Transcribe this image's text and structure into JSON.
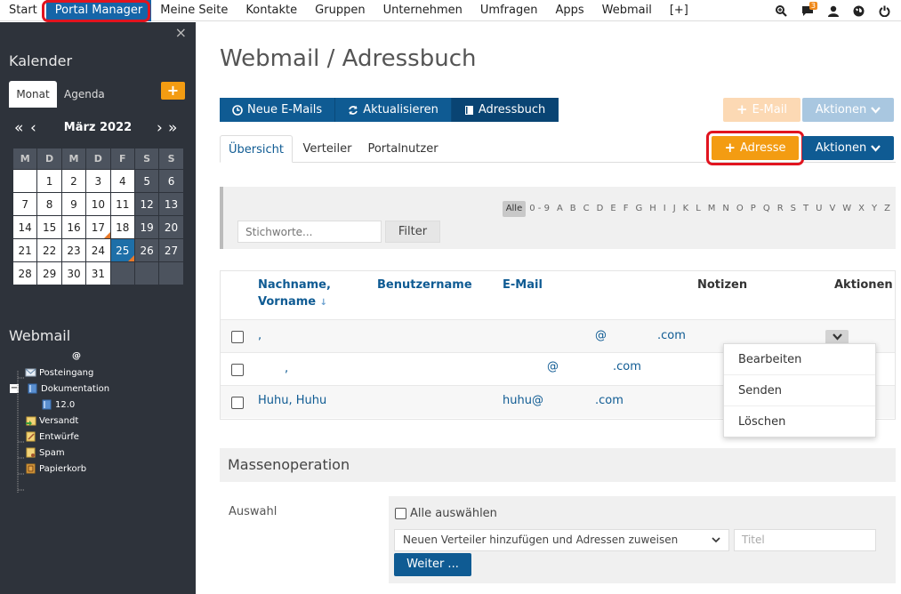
{
  "topnav": {
    "items": [
      "Start",
      "Portal Manager",
      "Meine Seite",
      "Kontakte",
      "Gruppen",
      "Unternehmen",
      "Umfragen",
      "Apps",
      "Webmail",
      "[+]"
    ],
    "active": "Portal Manager",
    "notification_count": "3"
  },
  "sidebar": {
    "close": "×",
    "calendar_heading": "Kalender",
    "tabs": [
      "Monat",
      "Agenda"
    ],
    "add": "+",
    "nav": {
      "prev_year": "«",
      "prev_month": "‹",
      "next_month": "›",
      "next_year": "»"
    },
    "month_label": "März 2022",
    "weekdays": [
      "M",
      "D",
      "M",
      "D",
      "F",
      "S",
      "S"
    ],
    "weeks": [
      [
        "",
        "1",
        "2",
        "3",
        "4",
        "5",
        "6"
      ],
      [
        "7",
        "8",
        "9",
        "10",
        "11",
        "12",
        "13"
      ],
      [
        "14",
        "15",
        "16",
        "17",
        "18",
        "19",
        "20"
      ],
      [
        "21",
        "22",
        "23",
        "24",
        "25",
        "26",
        "27"
      ],
      [
        "28",
        "29",
        "30",
        "31",
        "",
        "",
        ""
      ]
    ],
    "today": "25",
    "event_days": [
      "17",
      "25"
    ],
    "webmail_heading": "Webmail",
    "account": "@",
    "folders": {
      "inbox": "Posteingang",
      "docs": "Dokumentation",
      "docs_sub": "12.0",
      "sent": "Versandt",
      "drafts": "Entwürfe",
      "spam": "Spam",
      "trash": "Papierkorb"
    },
    "tree_toggle": "−"
  },
  "main": {
    "title": "Webmail / Adressbuch",
    "buttons": {
      "new_mail": "Neue E-Mails",
      "refresh": "Aktualisieren",
      "addressbook": "Adressbuch"
    },
    "email_button": "E-Mail",
    "actions_button": "Aktionen",
    "adresse_button": "Adresse",
    "tabs": [
      "Übersicht",
      "Verteiler",
      "Portalnutzer"
    ],
    "alphabet": [
      "Alle",
      "0 - 9",
      "A",
      "B",
      "C",
      "D",
      "E",
      "F",
      "G",
      "H",
      "I",
      "J",
      "K",
      "L",
      "M",
      "N",
      "O",
      "P",
      "Q",
      "R",
      "S",
      "T",
      "U",
      "V",
      "W",
      "X",
      "Y",
      "Z"
    ],
    "keyword_placeholder": "Stichworte...",
    "filter_button": "Filter",
    "table": {
      "col_name_1": "Nachname,",
      "col_name_2": "Vorname",
      "sort_icon": "↓",
      "col_username": "Benutzername",
      "col_email": "E-Mail",
      "col_notes": "Notizen",
      "col_actions": "Aktionen",
      "rows": [
        {
          "name": ",",
          "email_at": "@",
          "email_domain": ".com"
        },
        {
          "name": ",",
          "email_at": "@",
          "email_domain": ".com"
        },
        {
          "name": "Huhu, Huhu",
          "email_at": "huhu@",
          "email_domain": ".com"
        }
      ]
    },
    "dropdown": [
      "Bearbeiten",
      "Senden",
      "Löschen"
    ],
    "mass": {
      "heading": "Massenoperation",
      "label": "Auswahl",
      "select_all": "Alle auswählen",
      "select_value": "Neuen Verteiler hinzufügen und Adressen zuweisen",
      "title_placeholder": "Titel",
      "continue": "Weiter ..."
    }
  }
}
